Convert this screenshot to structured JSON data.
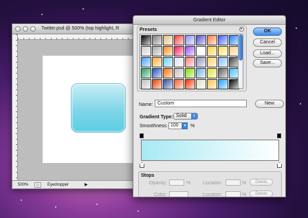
{
  "document": {
    "title": "Twitter.psd @ 500% (top highlight, R",
    "zoom": "500%",
    "tool": "Eyedropper"
  },
  "gradient_editor": {
    "title": "Gradient Editor",
    "presets_label": "Presets",
    "buttons": {
      "ok": "OK",
      "cancel": "Cancel",
      "load": "Load...",
      "save": "Save...",
      "new": "New"
    },
    "name_label": "Name:",
    "name_value": "Custom",
    "gradient_type_label": "Gradient Type:",
    "gradient_type_value": "Solid",
    "smoothness_label": "Smoothness:",
    "smoothness_value": "100",
    "percent_unit": "%",
    "gradient": {
      "start_color": "#a7e9f3",
      "end_color": "#ffffff"
    },
    "stops": {
      "group_label": "Stops",
      "opacity_label": "Opacity:",
      "color_label": "Color:",
      "location_label": "Location:",
      "delete_label": "Delete"
    },
    "presets": [
      "#000000",
      "#7c7c7c",
      "#e0c080",
      "#ff4040",
      "#9090ff",
      "#5050d0",
      "#ff8040",
      "#4060ff",
      "#2080ff",
      "#d0d0d0",
      "#aaaaaa",
      "#ff9020",
      "#ff2060",
      "#a050ff",
      "#ffffff",
      "#ffd040",
      "#ffe060",
      "#ffcc88",
      "#40a0ff",
      "#ffb030",
      "#60d0ff",
      "#e0e0ff",
      "#ff8080",
      "#9090c0",
      "#ffd060",
      "#80c0ff",
      "#404040",
      "#20a060",
      "#2050c0",
      "#ff7000",
      "#c0c0c0",
      "#80e000",
      "#70b0e0",
      "#e0e040",
      "#606060",
      "#40c0ff",
      "#c0c0c0",
      "#e04000",
      "#3050a0",
      "#ff6030",
      "#ff3000",
      "#e0e0c0",
      "#ffc050",
      "#20a0ff",
      "#000000"
    ]
  }
}
